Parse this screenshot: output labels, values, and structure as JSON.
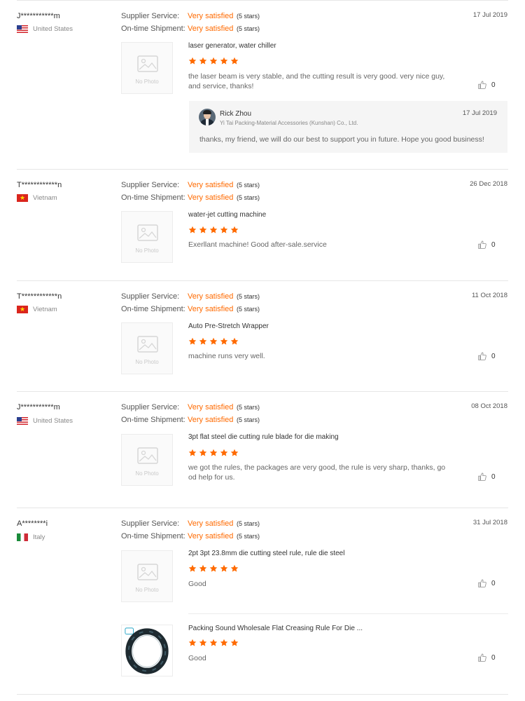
{
  "labels": {
    "supplier_service": "Supplier Service:",
    "ontime_shipment": "On-time Shipment:",
    "no_photo": "No Photo"
  },
  "reviews": [
    {
      "buyer": "J***********m",
      "country": "United States",
      "flag": "us",
      "supplier_service": "Very satisfied",
      "supplier_stars": "(5 stars)",
      "ontime_shipment": "Very satisfied",
      "ontime_stars": "(5 stars)",
      "date": "17 Jul 2019",
      "items": [
        {
          "product": "laser generator, water chiller",
          "rating": 5,
          "comment": "the laser beam is very stable, and the cutting result is very good. very nice guy, and service, thanks!",
          "likes": "0"
        }
      ],
      "reply": {
        "name": "Rick Zhou",
        "company": "Yi Tai Packing-Material Accessories (Kunshan) Co., Ltd.",
        "date": "17 Jul 2019",
        "text": "thanks, my friend, we will do our best to support you in future. Hope you good business!"
      }
    },
    {
      "buyer": "T************n",
      "country": "Vietnam",
      "flag": "vn",
      "supplier_service": "Very satisfied",
      "supplier_stars": "(5 stars)",
      "ontime_shipment": "Very satisfied",
      "ontime_stars": "(5 stars)",
      "date": "26 Dec 2018",
      "items": [
        {
          "product": "water-jet cutting machine",
          "rating": 5,
          "comment": "Exerllant machine! Good after-sale.service",
          "likes": "0"
        }
      ]
    },
    {
      "buyer": "T************n",
      "country": "Vietnam",
      "flag": "vn",
      "supplier_service": "Very satisfied",
      "supplier_stars": "(5 stars)",
      "ontime_shipment": "Very satisfied",
      "ontime_stars": "(5 stars)",
      "date": "11 Oct 2018",
      "items": [
        {
          "product": "Auto Pre-Stretch Wrapper",
          "rating": 5,
          "comment": "machine runs very well.",
          "likes": "0"
        }
      ]
    },
    {
      "buyer": "J***********m",
      "country": "United States",
      "flag": "us",
      "supplier_service": "Very satisfied",
      "supplier_stars": "(5 stars)",
      "ontime_shipment": "Very satisfied",
      "ontime_stars": "(5 stars)",
      "date": "08 Oct 2018",
      "items": [
        {
          "product": "3pt flat steel die cutting rule blade for die making",
          "rating": 5,
          "comment": "we got the rules, the packages are very good, the rule is very sharp, thanks, good help for us.",
          "likes": "0"
        }
      ]
    },
    {
      "buyer": "A********i",
      "country": "Italy",
      "flag": "it",
      "supplier_service": "Very satisfied",
      "supplier_stars": "(5 stars)",
      "ontime_shipment": "Very satisfied",
      "ontime_stars": "(5 stars)",
      "date": "31 Jul 2018",
      "items": [
        {
          "product": "2pt 3pt 23.8mm die cutting steel rule, rule die steel",
          "rating": 5,
          "comment": "Good",
          "likes": "0"
        },
        {
          "product": "Packing Sound Wholesale Flat Creasing Rule For Die ...",
          "rating": 5,
          "comment": "Good",
          "likes": "0"
        }
      ]
    }
  ],
  "colors": {
    "accent": "#ff6a00",
    "star": "#ff6a00",
    "divider": "#e6e6e6"
  }
}
